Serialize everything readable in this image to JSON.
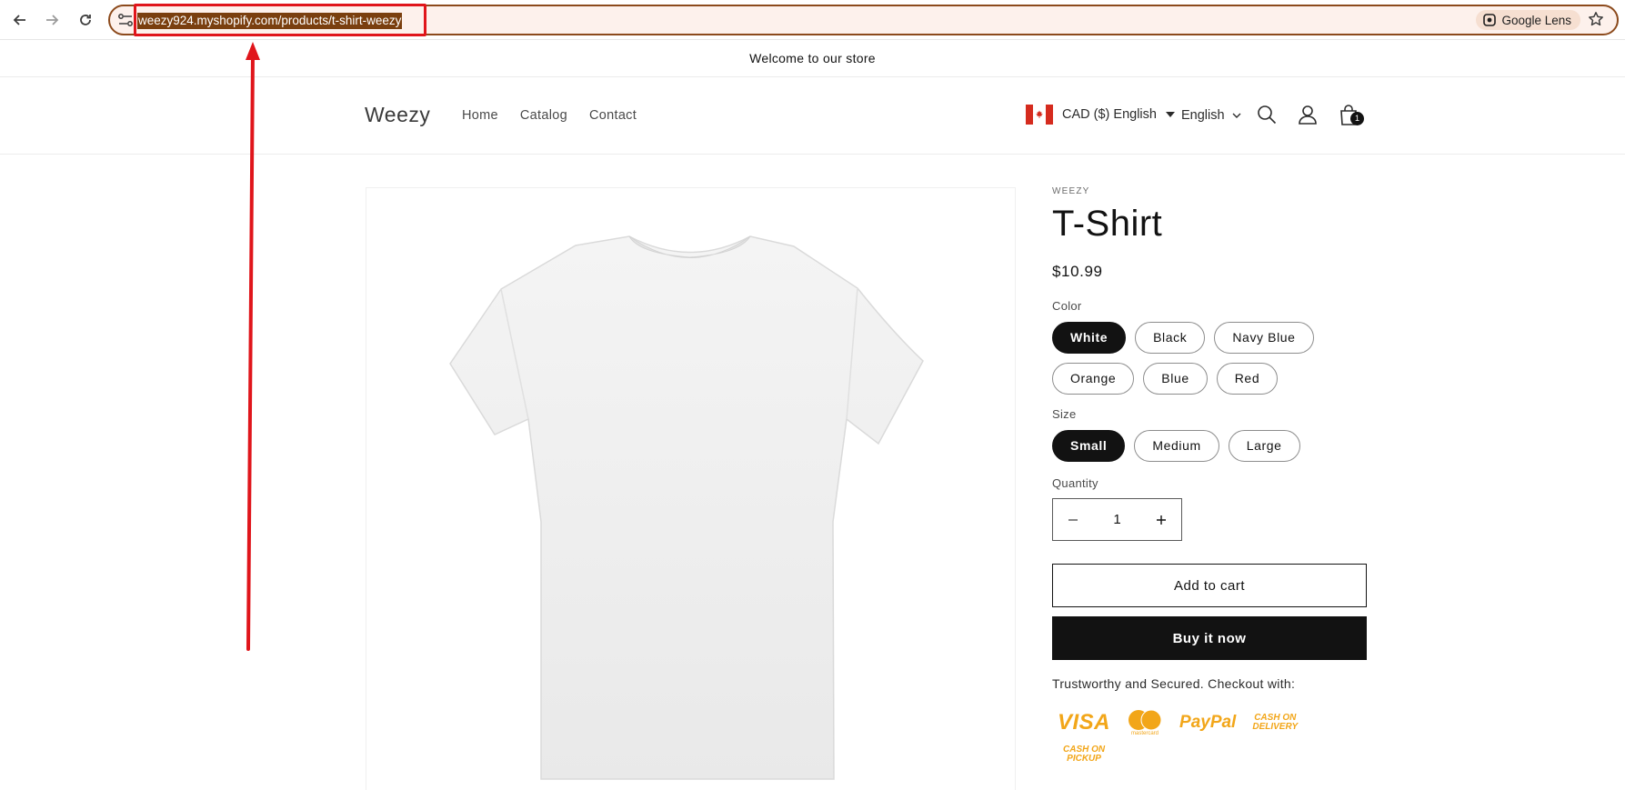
{
  "browser": {
    "url": "weezy924.myshopify.com/products/t-shirt-weezy",
    "lens_label": "Google Lens"
  },
  "announcement": "Welcome to our store",
  "header": {
    "logo": "Weezy",
    "menu": [
      "Home",
      "Catalog",
      "Contact"
    ],
    "currency": "CAD ($) English",
    "language": "English",
    "cart_count": "1"
  },
  "product": {
    "vendor": "WEEZY",
    "title": "T-Shirt",
    "price": "$10.99",
    "color_label": "Color",
    "colors": [
      "White",
      "Black",
      "Navy Blue",
      "Orange",
      "Blue",
      "Red"
    ],
    "selected_color": "White",
    "size_label": "Size",
    "sizes": [
      "Small",
      "Medium",
      "Large"
    ],
    "selected_size": "Small",
    "quantity_label": "Quantity",
    "quantity": "1",
    "add_to_cart": "Add to cart",
    "buy_now": "Buy it now",
    "trust_text": "Trustworthy and Secured. Checkout with:"
  },
  "payments": {
    "visa": "VISA",
    "mastercard": "mastercard",
    "paypal": "PayPal",
    "cod_line1": "CASH ON",
    "cod_line2": "DELIVERY",
    "cop_line1": "CASH ON",
    "cop_line2": "PICKUP"
  },
  "colors": {
    "accent": "#121212",
    "payment_icons": "#f2a619",
    "annotation": "#e0151b"
  }
}
